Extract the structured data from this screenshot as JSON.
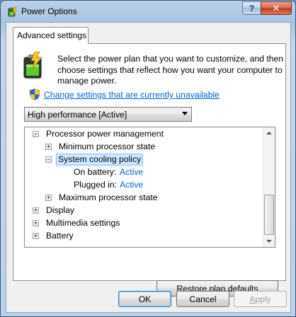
{
  "window": {
    "title": "Power Options",
    "help_label": "?",
    "close_label": "✕"
  },
  "tab": {
    "label": "Advanced settings"
  },
  "description": "Select the power plan that you want to customize, and then choose settings that reflect how you want your computer to manage power.",
  "change_link": "Change settings that are currently unavailable",
  "plan_select": {
    "value": "High performance [Active]"
  },
  "tree": {
    "processor_power_management": "Processor power management",
    "minimum_processor_state": "Minimum processor state",
    "system_cooling_policy": "System cooling policy",
    "on_battery_label": "On battery:",
    "on_battery_value": "Active",
    "plugged_in_label": "Plugged in:",
    "plugged_in_value": "Active",
    "maximum_processor_state": "Maximum processor state",
    "display": "Display",
    "multimedia_settings": "Multimedia settings",
    "battery": "Battery"
  },
  "buttons": {
    "restore_access_key": "R",
    "restore_rest": "estore plan defaults",
    "ok": "OK",
    "cancel": "Cancel",
    "apply_access_key": "A",
    "apply_rest": "pply"
  },
  "colors": {
    "link": "#0066cc",
    "selection": "#cde8ff"
  }
}
